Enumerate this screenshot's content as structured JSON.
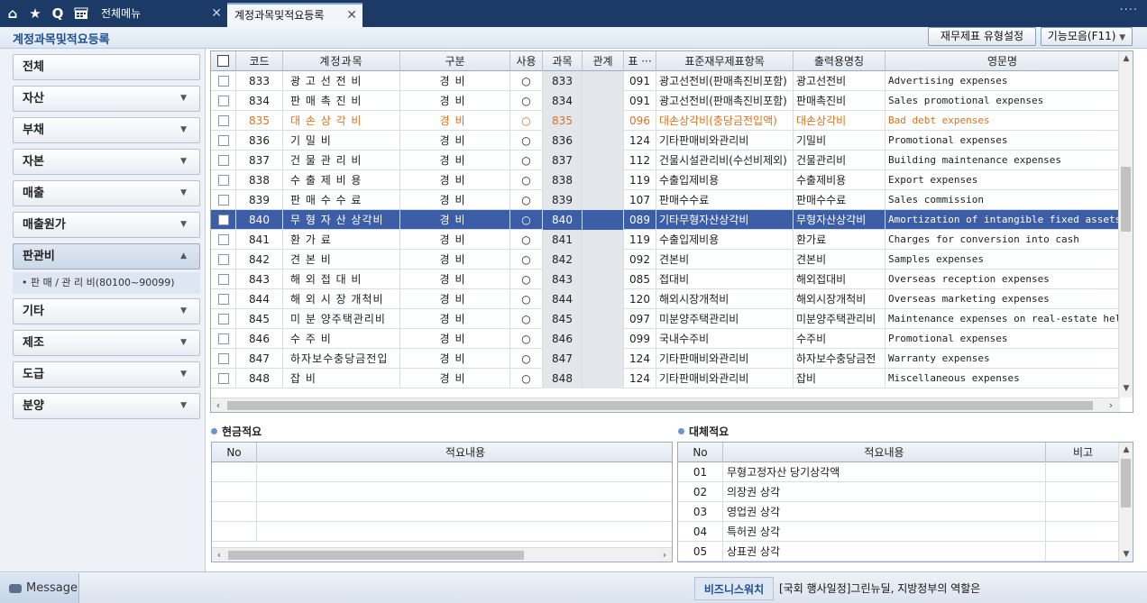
{
  "topbar": {
    "icons": [
      "home-icon",
      "star-icon",
      "search-icon",
      "calendar-icon"
    ],
    "tabs": [
      {
        "label": "전체메뉴",
        "active": false
      },
      {
        "label": "계정과목및적요등록",
        "active": true
      }
    ],
    "more": "····",
    "close_glyph": "✕"
  },
  "header": {
    "title": "계정과목및적요등록",
    "report_type_button": "재무제표 유형설정",
    "functions_button": "기능모음(F11)",
    "functions_arrow": "▼"
  },
  "sidebar": {
    "categories": [
      {
        "label": "전체",
        "arrow": ""
      },
      {
        "label": "자산",
        "arrow": "▼"
      },
      {
        "label": "부채",
        "arrow": "▼"
      },
      {
        "label": "자본",
        "arrow": "▼"
      },
      {
        "label": "매출",
        "arrow": "▼"
      },
      {
        "label": "매출원가",
        "arrow": "▼"
      },
      {
        "label": "판관비",
        "arrow": "▲"
      },
      {
        "label": "기타",
        "arrow": "▼"
      },
      {
        "label": "제조",
        "arrow": "▼"
      },
      {
        "label": "도급",
        "arrow": "▼"
      },
      {
        "label": "분양",
        "arrow": "▼"
      }
    ],
    "sub_item": "• 판 매 / 관 리 비(80100~90099)"
  },
  "grid": {
    "headers": {
      "code": "코드",
      "name": "계정과목",
      "type": "구분",
      "use": "사용",
      "subject": "과목",
      "relation": "관계",
      "std": "표 ···",
      "std_name": "표준재무제표항목",
      "print_name": "출력용명칭",
      "english": "영문명"
    },
    "use_mark": "○",
    "rows": [
      {
        "code": "833",
        "name": "광 고 선 전 비",
        "type": "경비",
        "subject": "833",
        "std": "091",
        "std_name": "광고선전비(판매촉진비포함)",
        "print_name": "광고선전비",
        "english": "Advertising expenses"
      },
      {
        "code": "834",
        "name": "판 매 촉 진 비",
        "type": "경비",
        "subject": "834",
        "std": "091",
        "std_name": "광고선전비(판매촉진비포함)",
        "print_name": "판매촉진비",
        "english": "Sales promotional expenses"
      },
      {
        "code": "835",
        "name": "대 손 상 각 비",
        "type": "경비",
        "subject": "835",
        "std": "096",
        "std_name": "대손상각비(충당금전입액)",
        "print_name": "대손상각비",
        "english": "Bad debt expenses"
      },
      {
        "code": "836",
        "name": "기      밀      비",
        "type": "경비",
        "subject": "836",
        "std": "124",
        "std_name": "기타판매비와관리비",
        "print_name": "기밀비",
        "english": "Promotional expenses"
      },
      {
        "code": "837",
        "name": "건 물 관 리 비",
        "type": "경비",
        "subject": "837",
        "std": "112",
        "std_name": "건물시설관리비(수선비제외)",
        "print_name": "건물관리비",
        "english": "Building maintenance expenses"
      },
      {
        "code": "838",
        "name": "수 출 제 비 용",
        "type": "경비",
        "subject": "838",
        "std": "119",
        "std_name": "수출입제비용",
        "print_name": "수출제비용",
        "english": "Export expenses"
      },
      {
        "code": "839",
        "name": "판 매 수 수 료",
        "type": "경비",
        "subject": "839",
        "std": "107",
        "std_name": "판매수수료",
        "print_name": "판매수수료",
        "english": "Sales commission"
      },
      {
        "code": "840",
        "name": "무 형 자 산 상각비",
        "type": "경비",
        "subject": "840",
        "std": "089",
        "std_name": "기타무형자산상각비",
        "print_name": "무형자산상각비",
        "english": "Amortization of intangible fixed assets"
      },
      {
        "code": "841",
        "name": "환      가      료",
        "type": "경비",
        "subject": "841",
        "std": "119",
        "std_name": "수출입제비용",
        "print_name": "환가료",
        "english": "Charges for conversion into cash"
      },
      {
        "code": "842",
        "name": "견      본      비",
        "type": "경비",
        "subject": "842",
        "std": "092",
        "std_name": "견본비",
        "print_name": "견본비",
        "english": "Samples expenses"
      },
      {
        "code": "843",
        "name": "해 외 접 대 비",
        "type": "경비",
        "subject": "843",
        "std": "085",
        "std_name": "접대비",
        "print_name": "해외접대비",
        "english": "Overseas reception expenses"
      },
      {
        "code": "844",
        "name": "해 외 시 장 개척비",
        "type": "경비",
        "subject": "844",
        "std": "120",
        "std_name": "해외시장개척비",
        "print_name": "해외시장개척비",
        "english": "Overseas marketing expenses"
      },
      {
        "code": "845",
        "name": "미 분 양주택관리비",
        "type": "경비",
        "subject": "845",
        "std": "097",
        "std_name": "미분양주택관리비",
        "print_name": "미분양주택관리비",
        "english": "Maintenance expenses on real-estate held f"
      },
      {
        "code": "846",
        "name": "수      주      비",
        "type": "경비",
        "subject": "846",
        "std": "099",
        "std_name": "국내수주비",
        "print_name": "수주비",
        "english": "Promotional expenses"
      },
      {
        "code": "847",
        "name": "하자보수충당금전입",
        "type": "경비",
        "subject": "847",
        "std": "124",
        "std_name": "기타판매비와관리비",
        "print_name": "하자보수충당금전",
        "english": "Warranty expenses"
      },
      {
        "code": "848",
        "name": "잡                비",
        "type": "경비",
        "subject": "848",
        "std": "124",
        "std_name": "기타판매비와관리비",
        "print_name": "잡비",
        "english": "Miscellaneous expenses"
      }
    ],
    "selected_index": 7,
    "highlight_index": 2,
    "scroll_up": "▲",
    "scroll_down": "▼",
    "scroll_left": "‹",
    "scroll_right": "›"
  },
  "cash_panel": {
    "title": "현금적요",
    "headers": {
      "no": "No",
      "content": "적요내용"
    }
  },
  "transfer_panel": {
    "title": "대체적요",
    "headers": {
      "no": "No",
      "content": "적요내용",
      "note": "비고"
    },
    "rows": [
      {
        "no": "01",
        "content": "무형고정자산 당기상각액"
      },
      {
        "no": "02",
        "content": "의장권 상각"
      },
      {
        "no": "03",
        "content": "영업권 상각"
      },
      {
        "no": "04",
        "content": "특허권 상각"
      },
      {
        "no": "05",
        "content": "상표권 상각"
      }
    ]
  },
  "statusbar": {
    "message_button": "Message",
    "business_watch_label": "비즈니스워치",
    "business_news": "[국회 행사일정]그린뉴딜, 지방정부의 역할은"
  },
  "colors": {
    "topbar": "#1b3a66",
    "selected_row": "#3c5ea6",
    "highlight_text": "#e0701a",
    "title_blue": "#1c4f92"
  }
}
